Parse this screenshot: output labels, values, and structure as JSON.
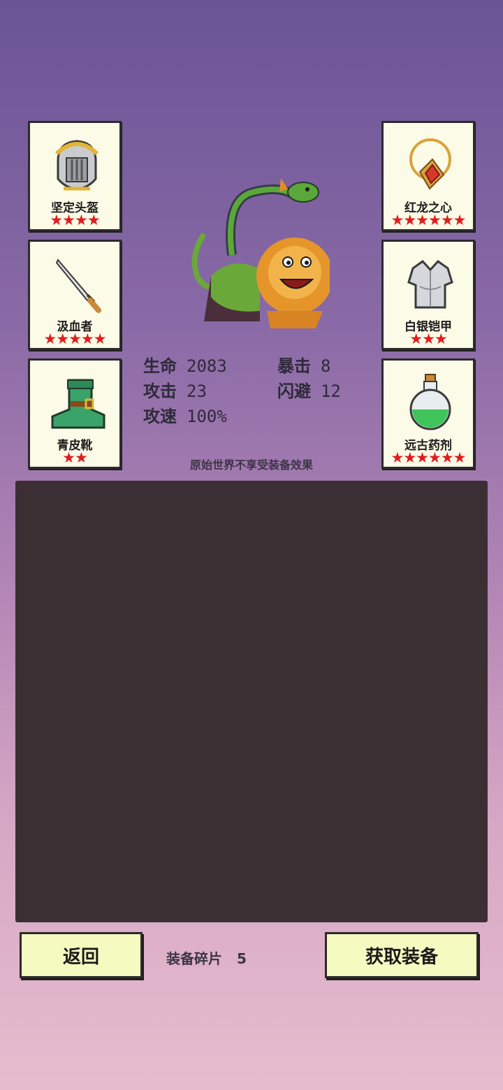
{
  "equipment_left": [
    {
      "name": "坚定头盔",
      "stars": "★★★★",
      "icon": "helmet-icon"
    },
    {
      "name": "汲血者",
      "stars": "★★★★★",
      "icon": "dagger-icon"
    },
    {
      "name": "青皮靴",
      "stars": "★★",
      "icon": "boot-icon"
    }
  ],
  "equipment_right": [
    {
      "name": "红龙之心",
      "stars": "★★★★★★",
      "icon": "amulet-icon"
    },
    {
      "name": "白银铠甲",
      "stars": "★★★",
      "icon": "armor-icon"
    },
    {
      "name": "远古药剂",
      "stars": "★★★★★★",
      "icon": "potion-icon"
    }
  ],
  "stats": {
    "hp_label": "生命",
    "hp_value": "2083",
    "crit_label": "暴击",
    "crit_value": "8",
    "atk_label": "攻击",
    "atk_value": "23",
    "dodge_label": "闪避",
    "dodge_value": "12",
    "speed_label": "攻速",
    "speed_value": "100%"
  },
  "note": "原始世界不享受装备效果",
  "footer": {
    "back_label": "返回",
    "shards_label": "装备碎片",
    "shards_value": "5",
    "get_label": "获取装备"
  }
}
